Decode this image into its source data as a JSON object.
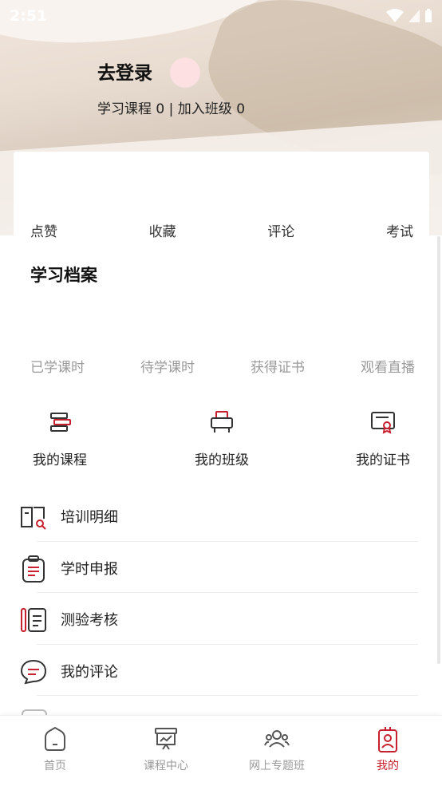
{
  "status_bar": {
    "time": "2:51"
  },
  "profile": {
    "login_label": "去登录",
    "courses_label": "学习课程",
    "courses_count": "0",
    "classes_label": "加入班级",
    "classes_count": "0"
  },
  "interactions": [
    "点赞",
    "收藏",
    "评论",
    "考试"
  ],
  "archive": {
    "title": "学习档案",
    "stats": [
      "已学课时",
      "待学课时",
      "获得证书",
      "观看直播"
    ]
  },
  "quick_actions": [
    {
      "label": "我的课程",
      "icon": "my-courses-icon"
    },
    {
      "label": "我的班级",
      "icon": "my-class-icon"
    },
    {
      "label": "我的证书",
      "icon": "my-certificate-icon"
    }
  ],
  "menu": [
    {
      "label": "培训明细",
      "icon": "training-detail-icon"
    },
    {
      "label": "学时申报",
      "icon": "clipboard-icon"
    },
    {
      "label": "测验考核",
      "icon": "exam-icon"
    },
    {
      "label": "我的评论",
      "icon": "comment-icon"
    }
  ],
  "tabbar": [
    {
      "label": "首页",
      "icon": "home-icon"
    },
    {
      "label": "课程中心",
      "icon": "course-center-icon"
    },
    {
      "label": "网上专题班",
      "icon": "online-class-icon"
    },
    {
      "label": "我的",
      "icon": "profile-badge-icon",
      "active": true
    }
  ],
  "colors": {
    "accent": "#c8202e",
    "muted": "#9a9a9a",
    "avatar_bg": "#fde0e2"
  }
}
